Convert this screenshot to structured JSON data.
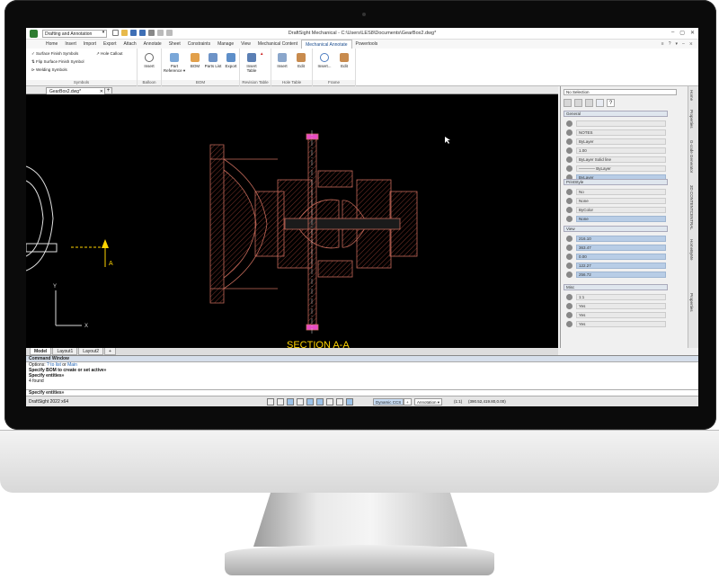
{
  "window": {
    "title": "DraftSight Mechanical - C:\\Users\\LES8\\Documents\\GearBox2.dwg*",
    "workspace": "Drafting and Annotation",
    "controls": [
      "–",
      "▢",
      "✕"
    ]
  },
  "ribbon_tabs": [
    "Home",
    "Insert",
    "Import",
    "Export",
    "Attach",
    "Annotate",
    "Sheet",
    "Constraints",
    "Manage",
    "View",
    "Mechanical Content",
    "Mechanical Annotate",
    "Powertools"
  ],
  "active_tab": "Mechanical Annotate",
  "ribbon_right": [
    "≡",
    "?",
    "▾",
    "–",
    "⨯"
  ],
  "ribbon": {
    "symbols": {
      "items": [
        "Surface Finish Symbols",
        "Flip Surface Finish Symbol",
        "Welding Symbols"
      ],
      "hole_callout": "Hole Callout",
      "label": "Symbols"
    },
    "balloon": {
      "insert": "Insert",
      "label": "Balloon"
    },
    "bom": {
      "part_reference": "Part Reference ▾",
      "bom": "BOM",
      "parts_list": "Parts List",
      "export": "Export",
      "label": "BOM"
    },
    "revision": {
      "insert_table": "Insert Table",
      "label": "Revision Table"
    },
    "hole_table": {
      "insert": "Insert",
      "edit": "Edit",
      "label": "Hole Table"
    },
    "frame": {
      "insert": "Insert...",
      "edit": "Edit",
      "label": "Frame"
    }
  },
  "doc_tab": "GearBox2.dwg*",
  "doc_add": "+",
  "canvas": {
    "section_label": "SECTION A-A",
    "marker": "A",
    "axis_x": "X",
    "axis_y": "Y"
  },
  "layout_tabs": [
    "Model",
    "Layout1",
    "Layout2",
    "+"
  ],
  "properties": {
    "selection": "No Selection",
    "groups": {
      "general": "General",
      "general_rows": [
        "",
        "NOTES",
        "ByLayer",
        "1.00",
        "ByLayer       Solid line",
        "———— ByLayer",
        "ByLayer"
      ],
      "printstyle": "PrintStyle",
      "printstyle_rows": [
        "No",
        "None",
        "ByColor",
        "None"
      ],
      "view": "View",
      "view_rows": [
        "216.10",
        "363.47",
        "0.00",
        "122.27",
        "256.72"
      ],
      "misc": "Misc",
      "misc_rows": [
        "1:1",
        "Yes",
        "Yes",
        "Yes"
      ]
    },
    "side_tabs": [
      "Home",
      "Properties",
      "G-code Generator",
      "3D CONTENTCENTRAL",
      "HomeByMe",
      "Properties"
    ]
  },
  "command": {
    "title": "Command Window",
    "lines": [
      {
        "pre": "Options: ",
        "opts": [
          "? to list",
          " or ",
          "Main"
        ]
      },
      {
        "text": "Specify BOM to create or set active»"
      },
      {
        "text": "Specify entities»"
      },
      {
        "text": "4 found"
      }
    ],
    "prompt": "Specify entities»"
  },
  "status": {
    "app": "DraftSight 2022 x64",
    "dynamic_ccs": "Dynamic CCS",
    "plus": "+",
    "annotation": "Annotation",
    "scale": "(1:1)",
    "coords": "(390.52,419.80,0.00)"
  },
  "colors": {
    "canvas": "#000000",
    "drawing": "#c46a5a",
    "section_label": "#ffd400",
    "accent": "#1b4d8f"
  }
}
